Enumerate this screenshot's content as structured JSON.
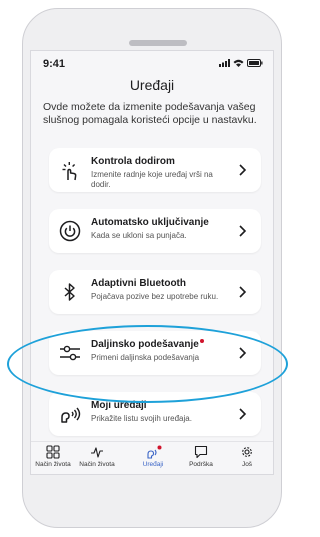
{
  "status": {
    "time": "9:41"
  },
  "header": {
    "title": "Uređaji"
  },
  "intro": "Ovde možete da izmenite podešavanja vašeg slušnog pomagala koristeći opcije u nastavku.",
  "cards": [
    {
      "title": "Kontrola dodirom",
      "subtitle": "Izmenite radnje koje uređaj vrši na dodir.",
      "icon": "touch-icon"
    },
    {
      "title": "Automatsko uključivanje",
      "subtitle": "Kada se ukloni sa punjača.",
      "icon": "power-icon"
    },
    {
      "title": "Adaptivni Bluetooth",
      "subtitle": "Pojačava pozive bez upotrebe ruku.",
      "icon": "bluetooth-icon"
    },
    {
      "title": "Daljinsko podešavanje",
      "subtitle": "Primeni daljinska podešavanja",
      "icon": "sliders-icon",
      "badge": true
    },
    {
      "title": "Moji uređaji",
      "subtitle": "Prikažite listu svojih uređaja.",
      "icon": "hearing-aid-icon"
    }
  ],
  "tabs": [
    {
      "label": "Način života",
      "icon": "grid-icon"
    },
    {
      "label": "Način života",
      "icon": "activity-icon"
    },
    {
      "label": "Uređaji",
      "icon": "devices-icon",
      "active": true
    },
    {
      "label": "Podrška",
      "icon": "chat-icon"
    },
    {
      "label": "Još",
      "icon": "gear-icon"
    }
  ],
  "colors": {
    "accent": "#3a64c6",
    "badge": "#d0142c",
    "highlight": "#1ea1d9"
  }
}
